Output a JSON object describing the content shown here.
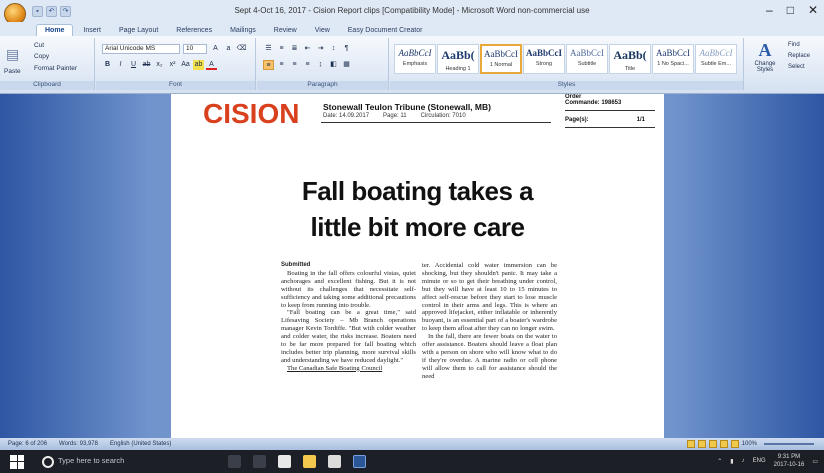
{
  "window": {
    "title": "Sept 4-Oct 16, 2017 - Cision Report clips [Compatibility Mode] - Microsoft Word non-commercial use"
  },
  "ribbon": {
    "tabs": [
      "Home",
      "Insert",
      "Page Layout",
      "References",
      "Mailings",
      "Review",
      "View",
      "Easy Document Creator"
    ],
    "active_tab": "Home",
    "clipboard": {
      "paste": "Paste",
      "cut": "Cut",
      "copy": "Copy",
      "format_painter": "Format Painter",
      "label": "Clipboard"
    },
    "font": {
      "name": "Arial Unicode MS",
      "size": "10",
      "label": "Font"
    },
    "paragraph": {
      "label": "Paragraph"
    },
    "styles": {
      "label": "Styles",
      "items": [
        {
          "sample": "AaBbCcI",
          "name": "Emphasis"
        },
        {
          "sample": "AaBb(",
          "name": "Heading 1"
        },
        {
          "sample": "AaBbCcI",
          "name": "1 Normal"
        },
        {
          "sample": "AaBbCcI",
          "name": "Strong"
        },
        {
          "sample": "AaBbCcI",
          "name": "Subtitle"
        },
        {
          "sample": "AaBb(",
          "name": "Title"
        },
        {
          "sample": "AaBbCcI",
          "name": "1 No Spaci..."
        },
        {
          "sample": "AaBbCcI",
          "name": "Subtle Em..."
        }
      ],
      "selected_index": 2,
      "change_styles": "Change Styles"
    },
    "editing": {
      "find": "Find",
      "replace": "Replace",
      "select": "Select",
      "label": "Editing"
    }
  },
  "document": {
    "logo": "CISION",
    "publication": "Stonewall Teulon Tribune (Stonewall, MB)",
    "date": "Date: 14.09.2017",
    "page": "Page: 11",
    "circulation": "Circulation: 7010",
    "order_label": "Order",
    "commande": "Commande: 198653",
    "pages_label": "Page(s):",
    "pages_value": "1/1",
    "headline_1": "Fall boating takes a",
    "headline_2": "little bit more care",
    "byline": "Submitted",
    "col1": [
      "Boating in the fall offers colourful vistas, quiet anchorages and excellent fishing. But it is not without its challenges that necessitate self-sufficiency and taking some additional precautions to keep from running into trouble.",
      "\"Fall boating can be a great time,\" said Lifesaving Society – Mb Branch operations manager Kevin Tordiffe. \"But with colder weather and colder water, the risks increase. Boaters need to be far more prepared for fall boating which includes better trip planning, more survival skills and understanding we have reduced daylight.\"",
      "The Canadian Safe Boating Council"
    ],
    "col2": [
      "ter. Accidental cold water immersion can be shocking, but they shouldn't panic. It may take a minute or so to get their breathing under control, but they will have at least 10 to 15 minutes to affect self-rescue before they start to lose muscle control in their arms and legs. This is where an approved lifejacket, either inflatable or inherently buoyant, is an essential part of a boater's wardrobe to keep them afloat after they can no longer swim.",
      "In the fall, there are fewer boats on the water to offer assistance. Boaters should leave a float plan with a person on shore who will know what to do if they're overdue. A marine radio or cell phone will allow them to call for assistance should the need"
    ]
  },
  "status": {
    "page": "Page: 6 of 206",
    "words": "Words: 93,978",
    "language": "English (United States)",
    "zoom": "100%"
  },
  "taskbar": {
    "search_placeholder": "Type here to search",
    "time": "9:31 PM",
    "date": "2017-10-16",
    "lang": "ENG"
  }
}
